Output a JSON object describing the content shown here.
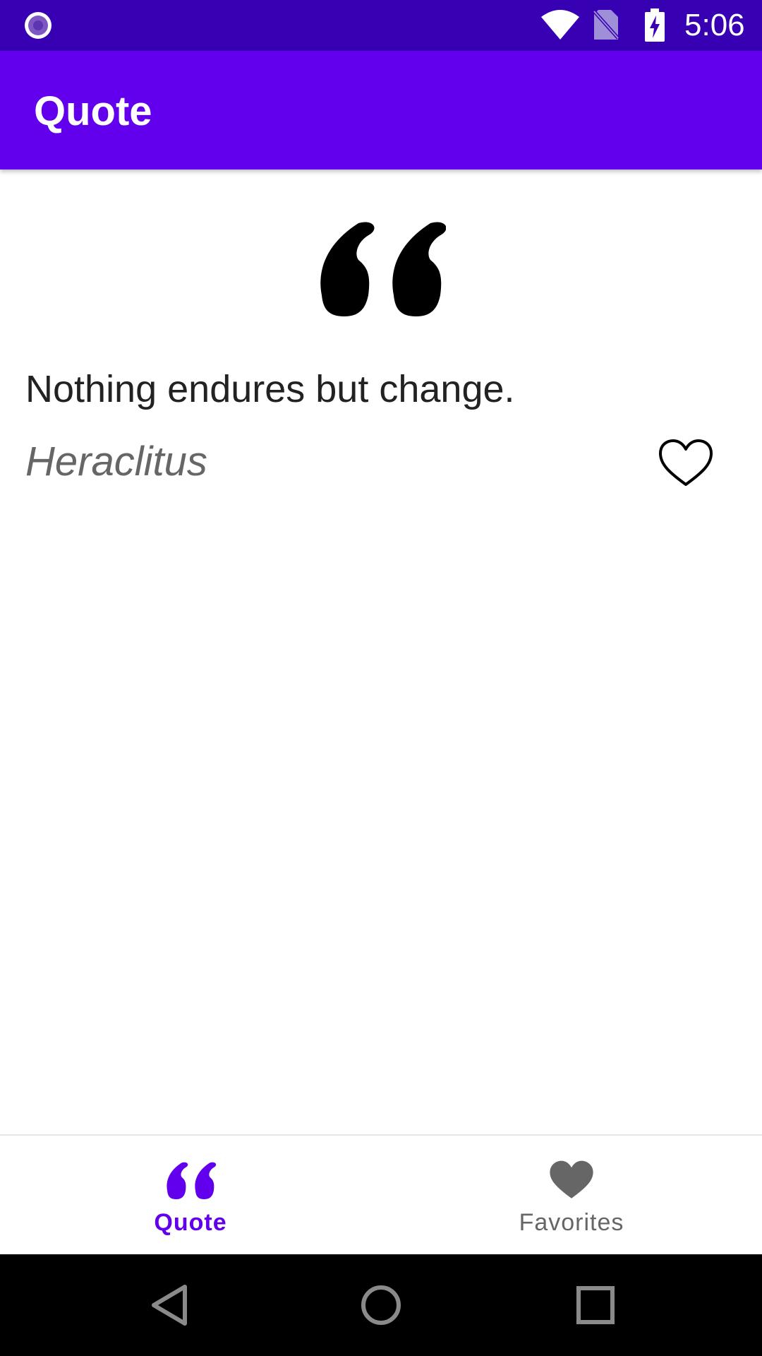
{
  "status_bar": {
    "time": "5:06",
    "icons": [
      "app-notification-icon",
      "wifi-icon",
      "no-sim-icon",
      "battery-charging-icon"
    ],
    "background": "#3700B3"
  },
  "app_bar": {
    "title": "Quote",
    "background": "#6200EE"
  },
  "quote": {
    "icon": "format-quote-icon",
    "text": "Nothing endures but change.",
    "author": "Heraclitus",
    "favorite_icon": "heart-outline-icon",
    "is_favorite": false
  },
  "bottom_nav": {
    "items": [
      {
        "label": "Quote",
        "icon": "format-quote-icon",
        "selected": true
      },
      {
        "label": "Favorites",
        "icon": "heart-icon",
        "selected": false
      }
    ],
    "accent": "#6200EE",
    "inactive": "#666666"
  },
  "system_nav": {
    "buttons": [
      "back-icon",
      "home-icon",
      "recents-icon"
    ]
  }
}
